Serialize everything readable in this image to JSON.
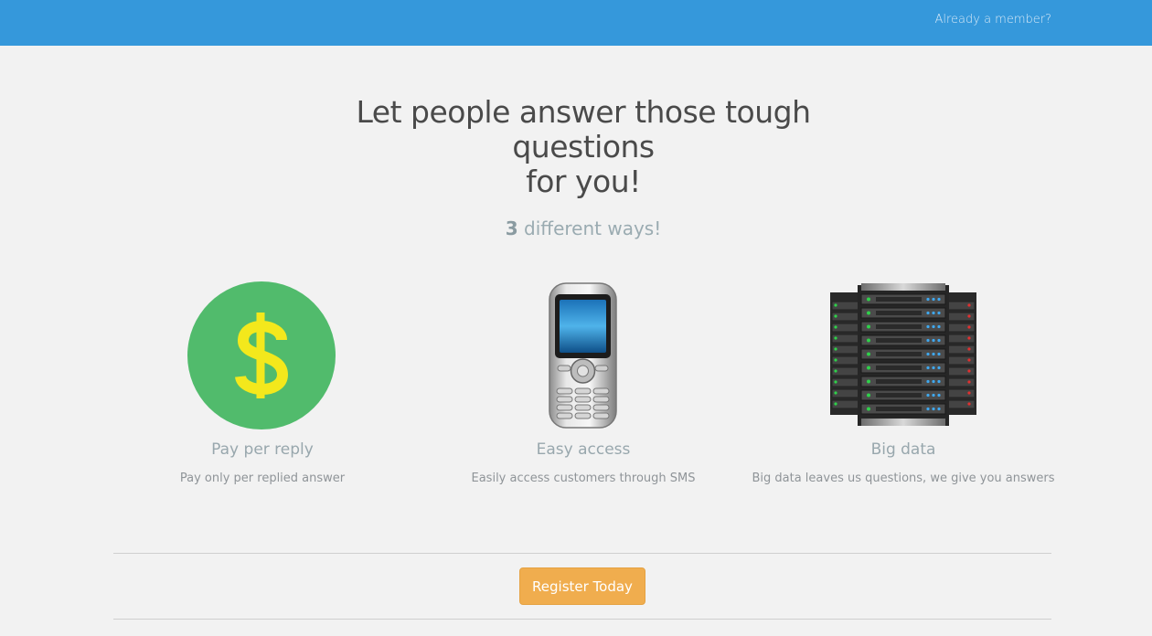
{
  "header": {
    "login_link": "Already a member?",
    "bar_color": "#3598db"
  },
  "hero": {
    "title_line1": "Let people answer those tough",
    "title_line2": "questions",
    "title_line3": "for you!",
    "subtitle_number": "3",
    "subtitle_rest": " different ways!"
  },
  "features": [
    {
      "icon": "dollar-coin-icon",
      "title": "Pay per reply",
      "description": "Pay only per replied answer"
    },
    {
      "icon": "mobile-phone-icon",
      "title": "Easy access",
      "description": "Easily access customers through SMS"
    },
    {
      "icon": "server-rack-icon",
      "title": "Big data",
      "description": "Big data leaves us questions, we give you answers"
    }
  ],
  "cta": {
    "label": "Register Today",
    "color": "#f0ad4e"
  }
}
